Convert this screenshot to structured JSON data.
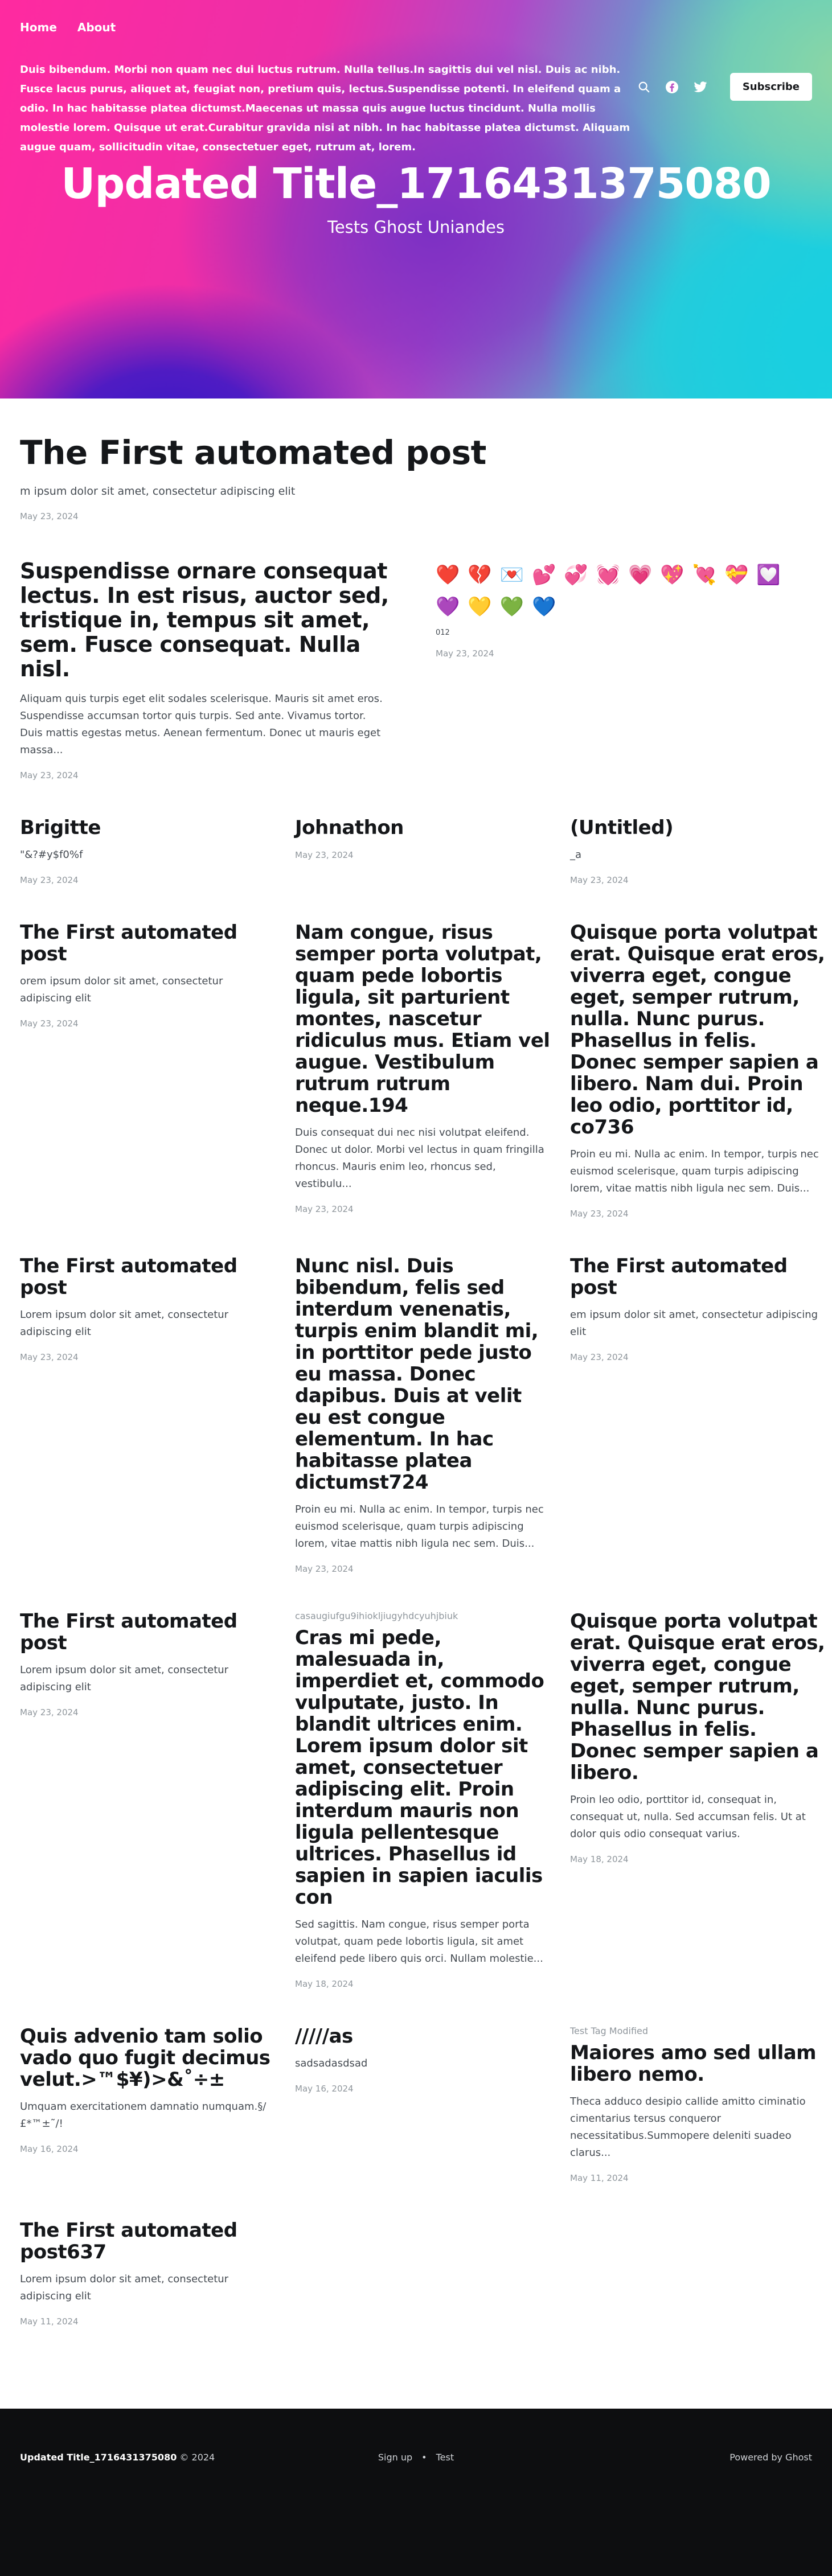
{
  "nav": {
    "home": "Home",
    "about": "About"
  },
  "hero": {
    "description": "Duis bibendum. Morbi non quam nec dui luctus rutrum. Nulla tellus.In sagittis dui vel nisl. Duis ac nibh. Fusce lacus purus, aliquet at, feugiat non, pretium quis, lectus.Suspendisse potenti. In eleifend quam a odio. In hac habitasse platea dictumst.Maecenas ut massa quis augue luctus tincidunt. Nulla mollis molestie lorem. Quisque ut erat.Curabitur gravida nisi at nibh. In hac habitasse platea dictumst. Aliquam augue quam, sollicitudin vitae, consectetuer eget, rutrum at, lorem.",
    "title": "Updated Title_1716431375080",
    "subtitle": "Tests Ghost Uniandes",
    "subscribe_label": "Subscribe"
  },
  "featured": {
    "title": "The First automated post",
    "excerpt": "m ipsum dolor sit amet, consectetur adipiscing elit",
    "date": "May 23, 2024"
  },
  "pair": [
    {
      "title": "Suspendisse ornare consequat lectus. In est risus, auctor sed, tristique in, tempus sit amet, sem. Fusce consequat. Nulla nisl.",
      "excerpt": "Aliquam quis turpis eget elit sodales scelerisque. Mauris sit amet eros. Suspendisse accumsan tortor quis turpis. Sed ante. Vivamus tortor. Duis mattis egestas metus. Aenean fermentum. Donec ut mauris eget massa...",
      "date": "May 23, 2024"
    },
    {
      "emojis": "❤️💔💌💕💞💓💗💖💘💝💟💜💛💚💙",
      "caption": "012",
      "date": "May 23, 2024"
    }
  ],
  "posts": [
    {
      "tag": "",
      "title": "Brigitte",
      "excerpt": "\"&?#y$f0%f",
      "date": "May 23, 2024"
    },
    {
      "tag": "",
      "title": "Johnathon",
      "excerpt": "",
      "date": "May 23, 2024"
    },
    {
      "tag": "",
      "title": "(Untitled)",
      "excerpt": "_a",
      "date": "May 23, 2024"
    },
    {
      "tag": "",
      "title": "The First automated post",
      "excerpt": "orem ipsum dolor sit amet, consectetur adipiscing elit",
      "date": "May 23, 2024"
    },
    {
      "tag": "",
      "title": "Nam congue, risus semper porta volutpat, quam pede lobortis ligula, sit parturient montes, nascetur ridiculus mus. Etiam vel augue. Vestibulum rutrum rutrum neque.194",
      "excerpt": "Duis consequat dui nec nisi volutpat eleifend. Donec ut dolor. Morbi vel lectus in quam fringilla rhoncus. Mauris enim leo, rhoncus sed, vestibulu...",
      "date": "May 23, 2024"
    },
    {
      "tag": "",
      "title": "Quisque porta volutpat erat. Quisque erat eros, viverra eget, congue eget, semper rutrum, nulla. Nunc purus. Phasellus in felis. Donec semper sapien a libero. Nam dui. Proin leo odio, porttitor id, co736",
      "excerpt": "Proin eu mi. Nulla ac enim. In tempor, turpis nec euismod scelerisque, quam turpis adipiscing lorem, vitae mattis nibh ligula nec sem. Duis...",
      "date": "May 23, 2024"
    },
    {
      "tag": "",
      "title": "The First automated post",
      "excerpt": "Lorem ipsum dolor sit amet, consectetur adipiscing elit",
      "date": "May 23, 2024"
    },
    {
      "tag": "",
      "title": "Nunc nisl. Duis bibendum, felis sed interdum venenatis, turpis enim blandit mi, in porttitor pede justo eu massa. Donec dapibus. Duis at velit eu est congue elementum. In hac habitasse platea dictumst724",
      "excerpt": "Proin eu mi. Nulla ac enim. In tempor, turpis nec euismod scelerisque, quam turpis adipiscing lorem, vitae mattis nibh ligula nec sem. Duis...",
      "date": "May 23, 2024"
    },
    {
      "tag": "",
      "title": "The First automated post",
      "excerpt": "em ipsum dolor sit amet, consectetur adipiscing elit",
      "date": "May 23, 2024"
    },
    {
      "tag": "",
      "title": "The First automated post",
      "excerpt": "Lorem ipsum dolor sit amet, consectetur adipiscing elit",
      "date": "May 23, 2024"
    },
    {
      "tag": "casaugiufgu9ihiokljiugyhdcyuhjbiuk",
      "title": "Cras mi pede, malesuada in, imperdiet et, commodo vulputate, justo. In blandit ultrices enim. Lorem ipsum dolor sit amet, consectetuer adipiscing elit. Proin interdum mauris non ligula pellentesque ultrices. Phasellus id sapien in sapien iaculis con",
      "excerpt": "Sed sagittis. Nam congue, risus semper porta volutpat, quam pede lobortis ligula, sit amet eleifend pede libero quis orci. Nullam molestie...",
      "date": "May 18, 2024"
    },
    {
      "tag": "",
      "title": "Quisque porta volutpat erat. Quisque erat eros, viverra eget, congue eget, semper rutrum, nulla. Nunc purus. Phasellus in felis. Donec semper sapien a libero.",
      "excerpt": "Proin leo odio, porttitor id, consequat in, consequat ut, nulla. Sed accumsan felis. Ut at dolor quis odio consequat varius.",
      "date": "May 18, 2024"
    },
    {
      "tag": "",
      "title": "Quis advenio tam solio vado quo fugit decimus velut.>™$¥)>&˚÷±",
      "excerpt": "Umquam exercitationem damnatio numquam.§/£*™±˜/!",
      "date": "May 16, 2024"
    },
    {
      "tag": "",
      "title": "/////as",
      "excerpt": "sadsadasdsad",
      "date": "May 16, 2024"
    },
    {
      "tag": "Test Tag Modified",
      "title": "Maiores amo sed ullam libero nemo.",
      "excerpt": "Theca adduco desipio callide amitto ciminatio cimentarius tersus conqueror necessitatibus.Summopere deleniti suadeo clarus...",
      "date": "May 11, 2024"
    },
    {
      "tag": "",
      "title": "The First automated post637",
      "excerpt": "Lorem ipsum dolor sit amet, consectetur adipiscing elit",
      "date": "May 11, 2024"
    }
  ],
  "footer": {
    "site_title": "Updated Title_1716431375080",
    "copyright": "© 2024",
    "link_signup": "Sign up",
    "link_test": "Test",
    "powered_by": "Powered by Ghost"
  }
}
